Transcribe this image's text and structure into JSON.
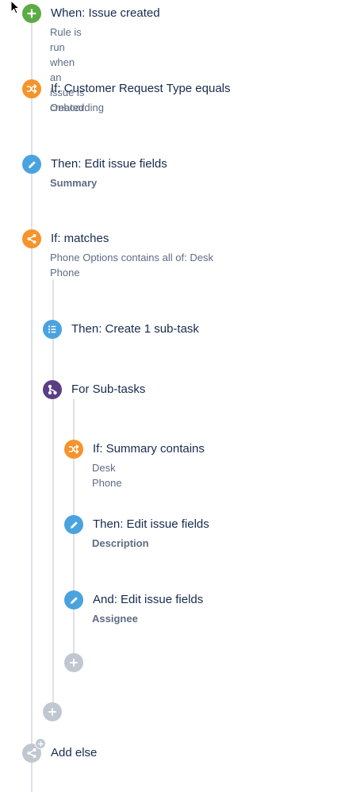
{
  "rule": {
    "trigger": {
      "title": "When: Issue created",
      "subtitle": "Rule is run when an issue is created."
    },
    "condition_request_type": {
      "title": "If: Customer Request Type equals",
      "subtitle": "Onboarding"
    },
    "action_edit_summary": {
      "title": "Then: Edit issue fields",
      "subtitle": "Summary"
    },
    "branch_matches": {
      "title": "If: matches",
      "subtitle": "Phone Options contains all of: Desk Phone"
    },
    "action_create_subtask": {
      "title": "Then: Create 1 sub-task"
    },
    "branch_subtasks": {
      "title": "For Sub-tasks"
    },
    "condition_summary": {
      "title": "If: Summary contains",
      "subtitle": "Desk Phone"
    },
    "action_edit_description": {
      "title": "Then: Edit issue fields",
      "subtitle": "Description"
    },
    "action_edit_assignee": {
      "title": "And: Edit issue fields",
      "subtitle": "Assignee"
    },
    "add_else": {
      "title": "Add else"
    }
  },
  "colors": {
    "trigger": "#5aac44",
    "condition": "#f7932a",
    "action": "#4aa3df",
    "branch": "#5a3e85",
    "add": "#c1c7d0",
    "connector": "#dfe1e6"
  },
  "icons": {
    "trigger": "plus-icon",
    "condition": "shuffle-icon",
    "action_edit": "pencil-icon",
    "branch": "share-icon",
    "action_create": "list-icon",
    "branch_for": "fork-icon",
    "add": "plus-icon",
    "cursor": "mouse-pointer-icon"
  }
}
